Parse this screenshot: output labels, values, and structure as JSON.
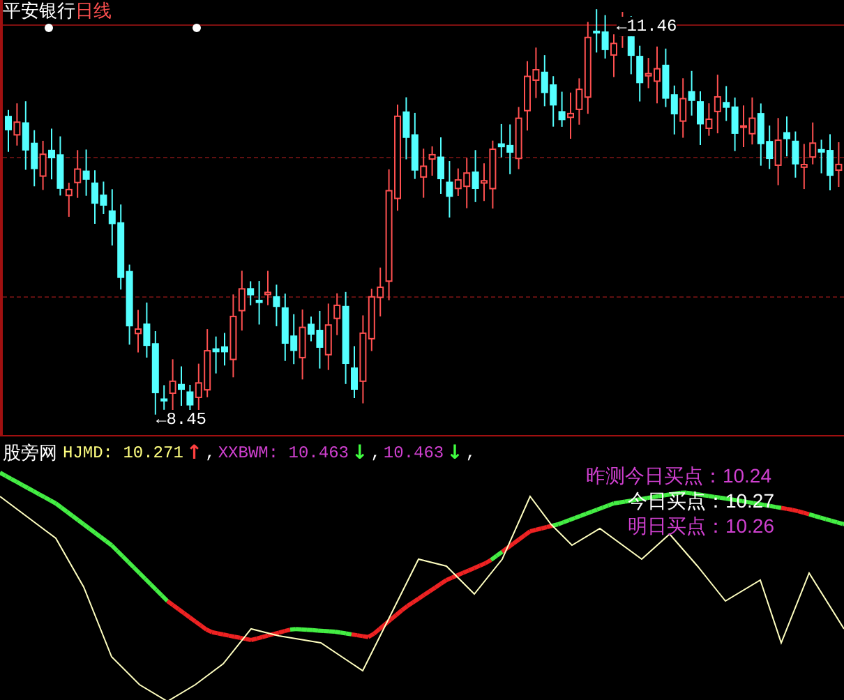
{
  "title": {
    "name": "平安银行",
    "period": "日线"
  },
  "price_marks": [
    {
      "kind": "high",
      "text": "←11.46"
    },
    {
      "kind": "low",
      "text": "←8.45"
    }
  ],
  "indicator": {
    "name": "股旁网",
    "items": [
      {
        "label": "HJMD: 10.271",
        "arrow": {
          "text": "↑",
          "color": "#ff4040"
        },
        "separator": ",",
        "color": "#ffff80"
      },
      {
        "label": "XXBWM: 10.463",
        "arrow": {
          "text": "↓",
          "color": "#40ff40"
        },
        "separator": ",",
        "color": "#d040d0"
      },
      {
        "label": "10.463",
        "arrow": {
          "text": "↓",
          "color": "#40ff40"
        },
        "separator": ",",
        "color": "#d040d0"
      }
    ]
  },
  "buy_points": [
    {
      "label": "昨测今日买点：10.24",
      "color": "#d040d0"
    },
    {
      "label": "今日买点：10.27",
      "color": "#ffffff"
    },
    {
      "label": "明日买点：10.26",
      "color": "#d040d0"
    }
  ]
}
